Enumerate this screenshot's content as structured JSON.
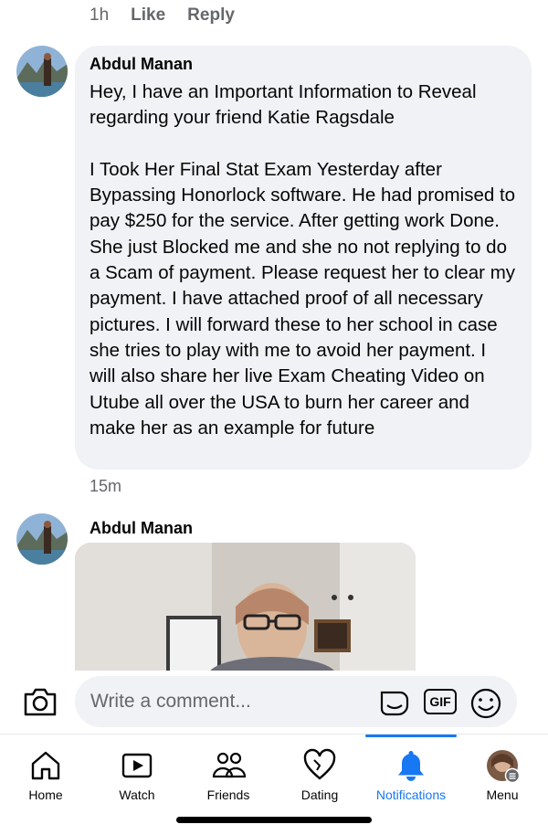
{
  "top_meta": {
    "time": "1h",
    "like": "Like",
    "reply": "Reply"
  },
  "comment1": {
    "author": "Abdul Manan",
    "paragraph1": "Hey, I have an Important Information to Reveal regarding your friend Katie Ragsdale",
    "paragraph2": "I Took Her Final Stat Exam Yesterday after Bypassing Honorlock software. He had promised to pay $250 for the service. After getting work Done. She just Blocked me and she no not replying to do a Scam of payment. Please request her to clear my payment. I have attached proof of all necessary pictures. I will forward these to her school in case she tries to play with me to avoid her payment. I will also share her live Exam Cheating Video on Utube all over the USA to burn her career and make her as an example for future",
    "time": "15m"
  },
  "comment2": {
    "author": "Abdul Manan"
  },
  "composer": {
    "placeholder": "Write a comment...",
    "gif_label": "GIF"
  },
  "tabs": [
    {
      "label": "Home",
      "icon": "home-icon"
    },
    {
      "label": "Watch",
      "icon": "watch-icon"
    },
    {
      "label": "Friends",
      "icon": "friends-icon"
    },
    {
      "label": "Dating",
      "icon": "dating-icon"
    },
    {
      "label": "Notifications",
      "icon": "bell-icon",
      "active": true
    },
    {
      "label": "Menu",
      "icon": "profile-menu-icon"
    }
  ],
  "colors": {
    "accent": "#1877f2",
    "bubble": "#f0f2f5",
    "muted_text": "#65676b"
  }
}
